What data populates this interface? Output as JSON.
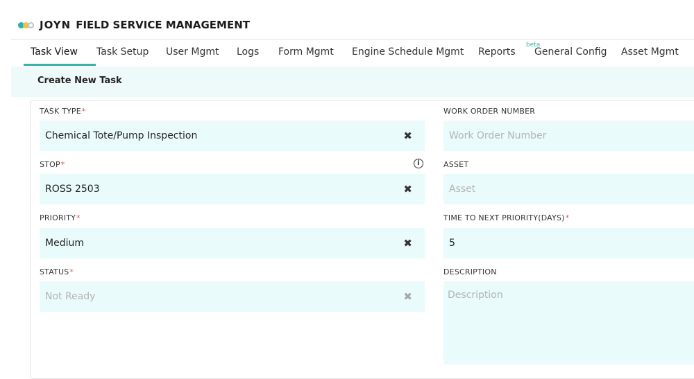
{
  "header": {
    "brand": "JOYN",
    "app_title": "FIELD SERVICE MANAGEMENT"
  },
  "tabs": [
    {
      "label": "Task View",
      "active": true
    },
    {
      "label": "Task Setup"
    },
    {
      "label": "User Mgmt"
    },
    {
      "label": "Logs"
    },
    {
      "label": "Form Mgmt"
    },
    {
      "label": "Engine Schedule Mgmt"
    },
    {
      "label": "Reports",
      "badge": "beta"
    },
    {
      "label": "General Config"
    },
    {
      "label": "Asset Mgmt"
    }
  ],
  "toolbar": {
    "create_label": "Create New Task"
  },
  "form": {
    "task_type": {
      "label": "TASK TYPE",
      "value": "Chemical Tote/Pump Inspection"
    },
    "stop": {
      "label": "STOP",
      "value": "ROSS 2503"
    },
    "priority": {
      "label": "PRIORITY",
      "value": "Medium"
    },
    "status": {
      "label": "STATUS",
      "placeholder": "Not Ready"
    },
    "work_order": {
      "label": "WORK ORDER NUMBER",
      "placeholder": "Work Order Number"
    },
    "asset": {
      "label": "ASSET",
      "placeholder": "Asset"
    },
    "time_to_next": {
      "label": "TIME TO NEXT PRIORITY(DAYS)",
      "value": "5"
    },
    "description": {
      "label": "DESCRIPTION",
      "placeholder": "Description"
    },
    "required_mark": "*",
    "clear_glyph": "✖",
    "info_glyph": "i"
  },
  "colors": {
    "accent": "#38b2a8",
    "field_bg": "#e9fbfa",
    "required": "#e05151"
  }
}
